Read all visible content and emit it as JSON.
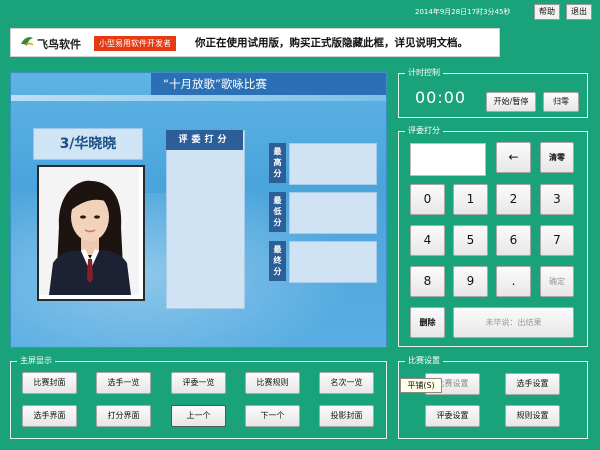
{
  "header": {
    "timestamp": "2014年9月28日17时3分45秒",
    "help_label": "帮助",
    "exit_label": "退出"
  },
  "banner": {
    "logo_text": "飞鸟软件",
    "version_tag": "小型易用软件开发者",
    "message": "你正在使用试用版，购买正式版隐藏此框，详见说明文档。"
  },
  "screen": {
    "title": "“十月放歌”歌咏比赛",
    "contestant": "3/华晓晓",
    "judges_header": "评委打分",
    "score_labels": [
      {
        "label": "最\n高\n分"
      },
      {
        "label": "最\n低\n分"
      },
      {
        "label": "最\n终\n分"
      }
    ]
  },
  "timer": {
    "group_label": "计时控制",
    "display": "00:00",
    "start_pause_label": "开始/暂停",
    "reset_label": "归零"
  },
  "scoring": {
    "group_label": "评委打分",
    "back_label": "←",
    "clear_label": "清零",
    "keys": [
      "0",
      "1",
      "2",
      "3",
      "4",
      "5",
      "6",
      "7",
      "8",
      "9",
      ".",
      "确定"
    ],
    "delete_label": "删除",
    "status_text": "未毕说：出结果"
  },
  "main_display": {
    "group_label": "主屏显示",
    "row1": [
      "比赛封面",
      "选手一览",
      "评委一览",
      "比赛规则",
      "名次一览"
    ],
    "row2": [
      "选手界面",
      "打分界面",
      "上一个",
      "下一个",
      "投影封面"
    ]
  },
  "settings": {
    "group_label": "比赛设置",
    "match_settings_label": "比赛设置",
    "tooltip_text": "平铺(S)",
    "player_settings_label": "选手设置",
    "judge_settings_label": "评委设置",
    "rules_settings_label": "规则设置"
  },
  "colors": {
    "background": "#1aa37a",
    "screen_blue": "#4aa4dc",
    "title_blue": "#2b6fb5",
    "banner_red": "#e63a12"
  }
}
